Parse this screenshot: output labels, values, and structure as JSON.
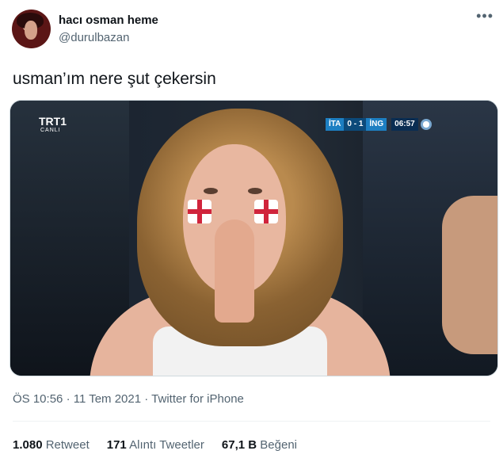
{
  "author": {
    "name": "hacı osman heme",
    "handle": "@durulbazan"
  },
  "tweet": {
    "text": "usman’ım nere şut çekersin"
  },
  "media": {
    "broadcaster": "TRT1",
    "live_label": "CANLI",
    "scoreboard": {
      "team1": "İTA",
      "score": "0 - 1",
      "team2": "İNG",
      "time": "06:57"
    }
  },
  "meta": {
    "time": "ÖS 10:56",
    "separator": "·",
    "date": "11 Tem 2021",
    "source": "Twitter for iPhone"
  },
  "stats": [
    {
      "count": "1.080",
      "label": "Retweet"
    },
    {
      "count": "171",
      "label": "Alıntı Tweetler"
    },
    {
      "count": "67,1 B",
      "label": "Beğeni"
    }
  ],
  "more_icon": "more-horizontal-icon"
}
